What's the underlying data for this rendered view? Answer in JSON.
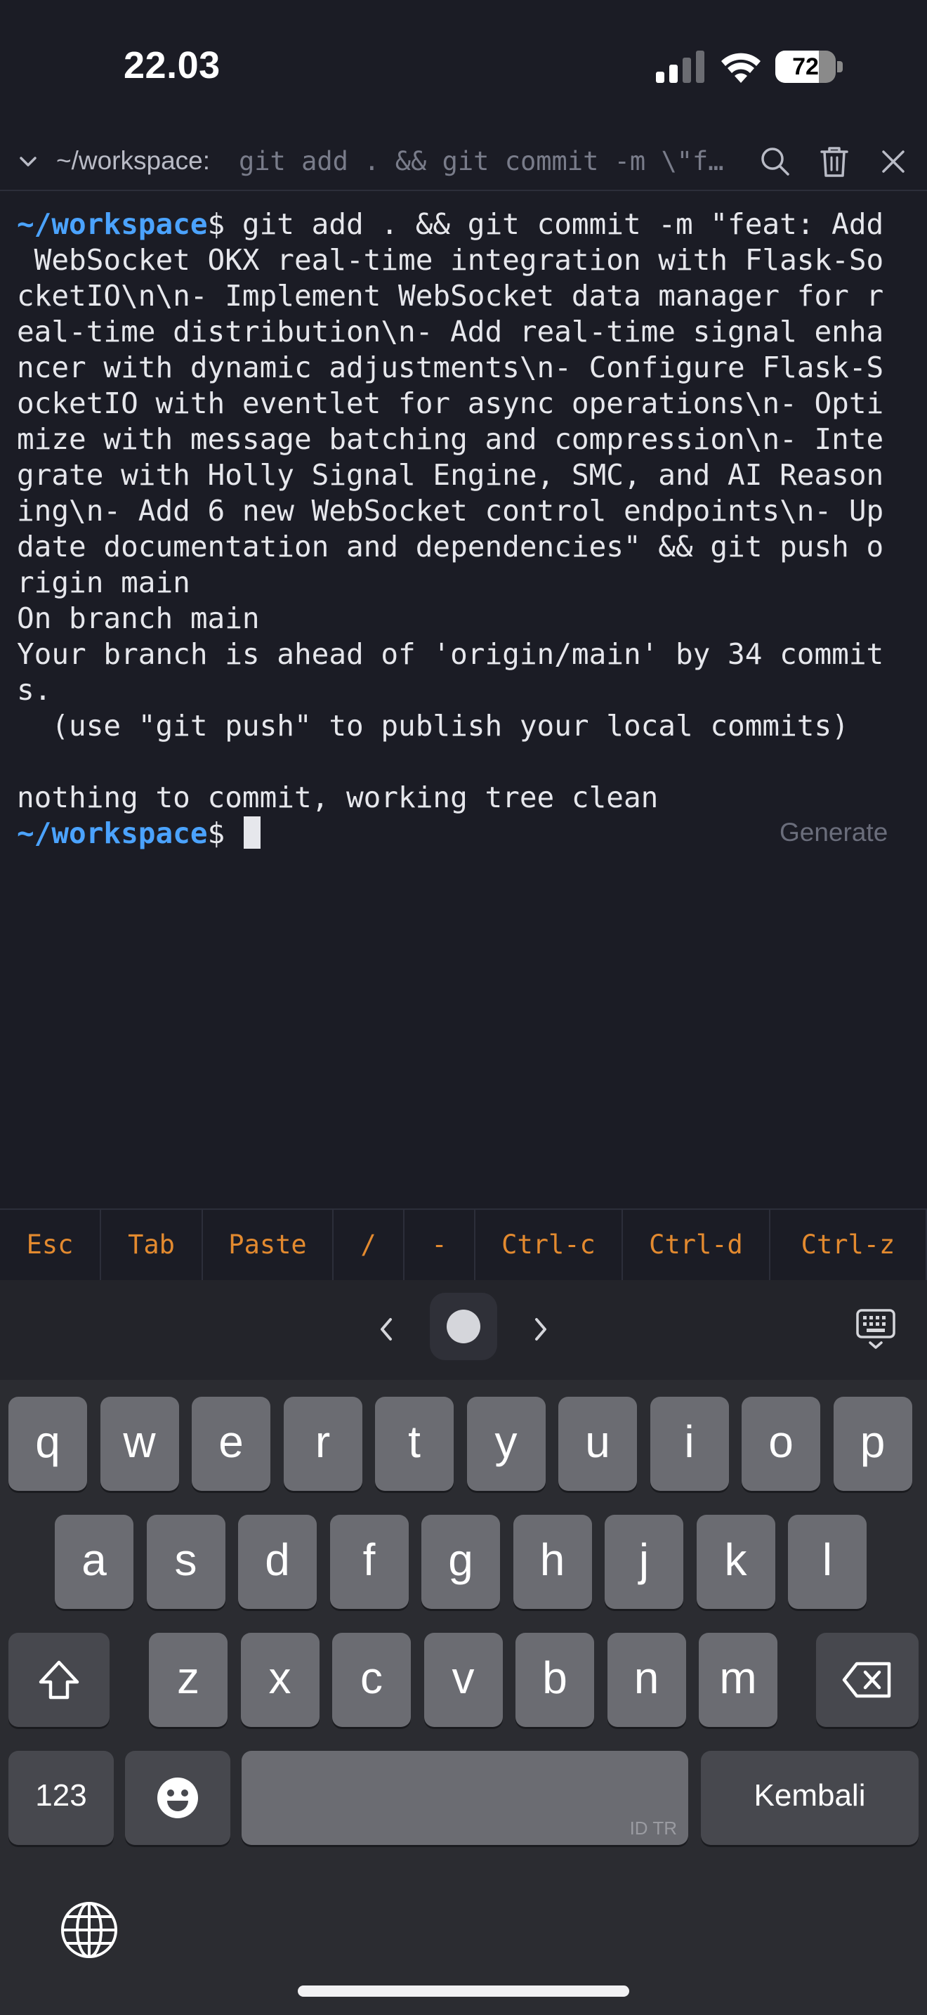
{
  "status_bar": {
    "time": "22.03",
    "battery_level": "72",
    "battery_fraction": 0.72
  },
  "title_bar": {
    "path": "~/workspace:",
    "command": "git add . && git commit -m \\\"fe…"
  },
  "terminal": {
    "prompt": "~/workspace",
    "lines": [
      " WebSocket OKX real-time integration with Flask-So",
      "cketIO\\n\\n- Implement WebSocket data manager for r",
      "eal-time distribution\\n- Add real-time signal enha",
      "ncer with dynamic adjustments\\n- Configure Flask-S",
      "ocketIO with eventlet for async operations\\n- Opti",
      "mize with message batching and compression\\n- Inte",
      "grate with Holly Signal Engine, SMC, and AI Reason",
      "ing\\n- Add 6 new WebSocket control endpoints\\n- Up",
      "date documentation and dependencies\" && git push o",
      "rigin main",
      "On branch main",
      "Your branch is ahead of 'origin/main' by 34 commit",
      "s.",
      "  (use \"git push\" to publish your local commits)",
      "",
      "nothing to commit, working tree clean"
    ],
    "first_command": "$ git add . && git commit -m \"feat: Add",
    "last_prompt_suffix": "$ ",
    "generate_label": "Generate"
  },
  "extra_keys": [
    "Esc",
    "Tab",
    "Paste",
    "/",
    "-",
    "Ctrl-c",
    "Ctrl-d",
    "Ctrl-z"
  ],
  "keyboard": {
    "row1": [
      "q",
      "w",
      "e",
      "r",
      "t",
      "y",
      "u",
      "i",
      "o",
      "p"
    ],
    "row2": [
      "a",
      "s",
      "d",
      "f",
      "g",
      "h",
      "j",
      "k",
      "l"
    ],
    "row3": [
      "z",
      "x",
      "c",
      "v",
      "b",
      "n",
      "m"
    ],
    "numbers_label": "123",
    "return_label": "Kembali",
    "space_language": "ID TR"
  }
}
